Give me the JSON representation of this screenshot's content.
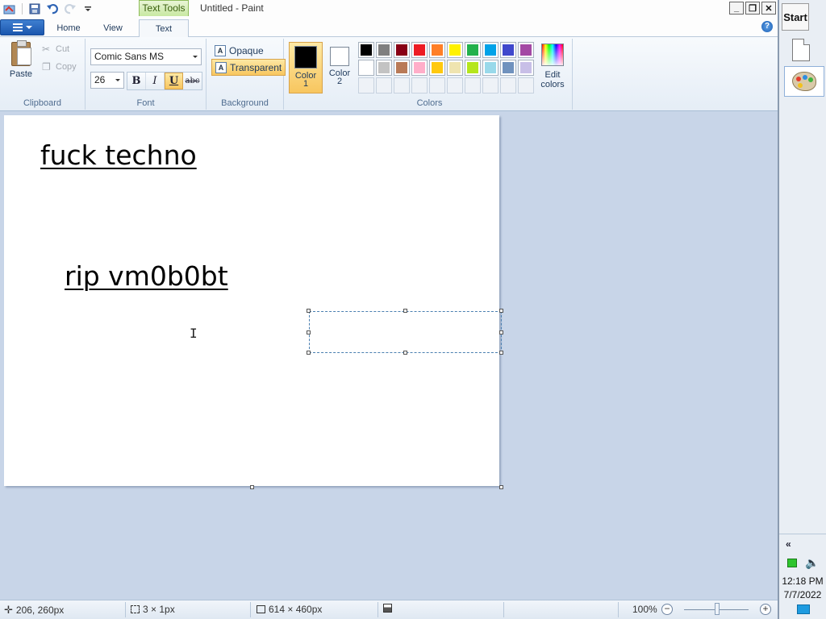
{
  "titlebar": {
    "title": "Untitled - Paint",
    "context_tab_header": "Text Tools",
    "controls": {
      "minimize": "_",
      "restore": "❐",
      "close": "✕"
    }
  },
  "tabs": [
    {
      "label": "Home"
    },
    {
      "label": "View"
    },
    {
      "label": "Text",
      "active": true
    }
  ],
  "help_icon": "?",
  "ribbon": {
    "clipboard": {
      "paste": "Paste",
      "cut": "Cut",
      "copy": "Copy",
      "label": "Clipboard"
    },
    "font": {
      "family": "Comic Sans MS",
      "size": "26",
      "bold": "B",
      "italic": "I",
      "underline": "U",
      "strikethrough": "abc",
      "label": "Font"
    },
    "background": {
      "opaque": "Opaque",
      "transparent": "Transparent",
      "label": "Background"
    },
    "colors": {
      "color1_label": "Color\n1",
      "color1_line1": "Color",
      "color1_line2": "1",
      "color2_line1": "Color",
      "color2_line2": "2",
      "color1_value": "#000000",
      "color2_value": "#ffffff",
      "edit_line1": "Edit",
      "edit_line2": "colors",
      "label": "Colors",
      "palette_row1": [
        "#000000",
        "#7f7f7f",
        "#880015",
        "#ed1c24",
        "#ff7f27",
        "#fff200",
        "#22b14c",
        "#00a2e8",
        "#3f48cc",
        "#a349a4"
      ],
      "palette_row2": [
        "#ffffff",
        "#c3c3c3",
        "#b97a57",
        "#ffaec9",
        "#ffc90e",
        "#efe4b0",
        "#b5e61d",
        "#99d9ea",
        "#7092be",
        "#c8bfe7"
      ]
    }
  },
  "canvas": {
    "text1": "fuck techno",
    "text2": "rip vm0b0bt"
  },
  "statusbar": {
    "cursor_pos": "206, 260px",
    "selection_size": "3 × 1px",
    "image_size": "614 × 460px",
    "zoom": "100%"
  },
  "sidebar": {
    "start": "Start",
    "collapse": "«",
    "time": "12:18 PM",
    "date": "7/7/2022"
  }
}
